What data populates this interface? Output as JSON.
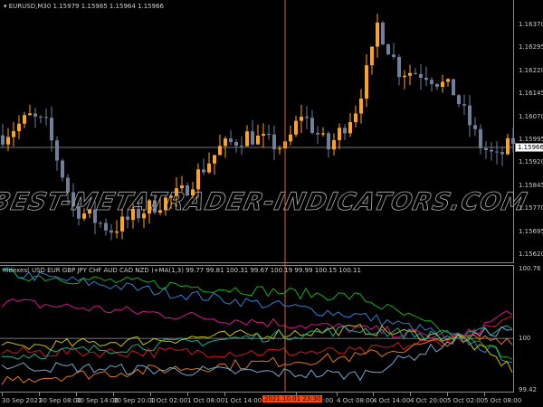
{
  "chart": {
    "symbol_label": "EURUSD,M30",
    "ohlc": "1.15979 1.15985 1.15964 1.15966",
    "current_price": "1.15966",
    "price_axis": [
      "1.16370",
      "1.16295",
      "1.16220",
      "1.16145",
      "1.16070",
      "1.15995",
      "1.15920",
      "1.15845",
      "1.15770",
      "1.15695",
      "1.15620"
    ],
    "bull_color": "#ffa31a",
    "bear_color": "#6d7f99",
    "price_waypoints": [
      [
        0,
        1.16008
      ],
      [
        5,
        1.16067
      ],
      [
        8,
        1.1604
      ],
      [
        13,
        1.15773
      ],
      [
        20,
        1.157
      ],
      [
        27,
        1.15773
      ],
      [
        33,
        1.1582
      ],
      [
        40,
        1.15965
      ],
      [
        45,
        1.16008
      ],
      [
        52,
        1.15965
      ],
      [
        55,
        1.1608
      ],
      [
        60,
        1.15965
      ],
      [
        65,
        1.16095
      ],
      [
        68,
        1.1627
      ],
      [
        69,
        1.1637
      ],
      [
        73,
        1.1622
      ],
      [
        78,
        1.1621
      ],
      [
        83,
        1.1615
      ],
      [
        88,
        1.15975
      ],
      [
        91,
        1.1593
      ],
      [
        94,
        1.1599
      ]
    ]
  },
  "watermark": "BEST-METATRADER-INDICATORS.COM",
  "indicator": {
    "title": "Indexes( USD EUR GBP JPY CHF AUD CAD NZD )+MA(1,3) 99.77 99.81 100.31 99.67 100.19 99.99 100.15 100.11",
    "axis": {
      "top": "100.76",
      "mid": "100",
      "bottom": "99.42"
    },
    "currencies": [
      {
        "name": "USD",
        "color": "#2f7fd0",
        "last": 99.77
      },
      {
        "name": "EUR",
        "color": "#12b312",
        "last": 99.81
      },
      {
        "name": "GBP",
        "color": "#d0188a",
        "last": 100.31
      },
      {
        "name": "JPY",
        "color": "#c8c000",
        "last": 99.67
      },
      {
        "name": "CHF",
        "color": "#d01818",
        "last": 100.19
      },
      {
        "name": "AUD",
        "color": "#e07810",
        "last": 99.99
      },
      {
        "name": "CAD",
        "color": "#10b090",
        "last": 100.15
      },
      {
        "name": "NZD",
        "color": "#70a8d0",
        "last": 100.11
      }
    ]
  },
  "time_axis": {
    "labels": [
      "30 Sep 2021",
      "30 Sep 08:00",
      "30 Sep 14:00",
      "30 Sep 20:00",
      "1 Oct 02:00",
      "1 Oct 08:00",
      "1 Oct 14:00",
      "4 Oct 02:00",
      "4 Oct 08:00",
      "4 Oct 14:00",
      "4 Oct 20:00",
      "5 Oct 02:00",
      "5 Oct 08:00"
    ],
    "crosshair_time": "2021.10.01 23:30"
  }
}
